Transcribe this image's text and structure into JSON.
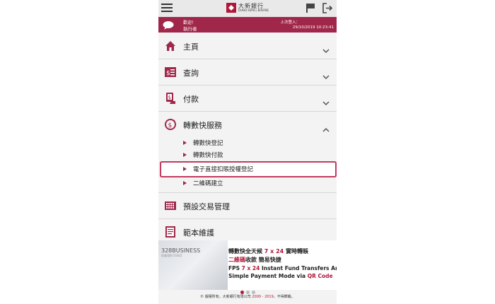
{
  "header": {
    "logo_zh": "大新銀行",
    "logo_en": "DAH SING BANK"
  },
  "welcome": {
    "greeting": "歡迎！",
    "name": "執行者",
    "last_login_label": "上次登入：",
    "last_login_time": "29/10/2019 10:23:41"
  },
  "menu": {
    "items": [
      {
        "label": "主頁",
        "icon": "home-icon"
      },
      {
        "label": "查詢",
        "icon": "enquiry-icon"
      },
      {
        "label": "付款",
        "icon": "payment-icon"
      },
      {
        "label": "轉數快服務",
        "icon": "fps-icon"
      }
    ],
    "fps_sub": [
      {
        "label": "轉數快登記"
      },
      {
        "label": "轉數快付款"
      },
      {
        "label": "電子直接扣賬授權登記"
      },
      {
        "label": "二維碼建立"
      }
    ],
    "more": [
      {
        "label": "預設交易管理",
        "icon": "calendar-icon"
      },
      {
        "label": "範本維護",
        "icon": "template-icon"
      }
    ]
  },
  "banner": {
    "brand": "328BUSINESS",
    "brand_sub": "商業理財 DSBIZ",
    "line1_a": "轉數快全天候 ",
    "line1_b": "7 x 24",
    "line1_c": " 實時轉賬",
    "line2_a": "二維碼",
    "line2_b": "收款  簡易快捷",
    "line3_a": "FPS ",
    "line3_b": "7 x 24",
    "line3_c": " Instant Fund Transfers Anytime",
    "line4_a": "Simple Payment Mode via ",
    "line4_b": "QR Code"
  },
  "footer": {
    "prefix": "© 版權所有，大新銀行有限公司 ",
    "years": "2000 - 2019",
    "suffix": "，不得轉載。"
  },
  "colors": {
    "brand": "#a0274a",
    "highlight": "#c23a60"
  }
}
